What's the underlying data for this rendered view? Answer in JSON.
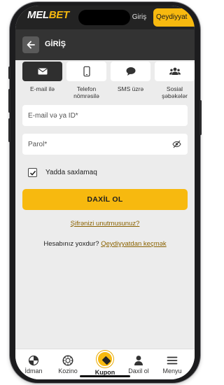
{
  "brand": {
    "mel": "MEL",
    "bet": "BET"
  },
  "header": {
    "login_label": "Giriş",
    "register_label": "Qeydiyyat"
  },
  "page_title": "GİRİŞ",
  "tabs": [
    {
      "label": "E-mail ilə",
      "icon": "envelope-icon",
      "active": true
    },
    {
      "label": "Telefon nömrəsilə",
      "icon": "phone-icon",
      "active": false
    },
    {
      "label": "SMS üzrə",
      "icon": "chat-icon",
      "active": false
    },
    {
      "label": "Sosial şəbəkələr",
      "icon": "people-icon",
      "active": false
    }
  ],
  "form": {
    "email_placeholder": "E-mail və ya İD*",
    "password_placeholder": "Parol*",
    "remember_label": "Yadda saxlamaq",
    "remember_checked": true,
    "submit_label": "DAXİL OL",
    "forgot_label": "Şifrənizi unutmusunuz?",
    "no_account_text": "Hesabınız yoxdur?",
    "register_link": "Qeydiyyatdan keçmək"
  },
  "bottom_nav": {
    "items": [
      {
        "label": "İdman",
        "icon": "sport-icon"
      },
      {
        "label": "Kozino",
        "icon": "casino-chip-icon"
      },
      {
        "label": "Kupon",
        "icon": "coupon-icon"
      },
      {
        "label": "Daxil ol",
        "icon": "user-icon"
      },
      {
        "label": "Menyu",
        "icon": "menu-icon"
      }
    ]
  },
  "colors": {
    "accent": "#f7b90f",
    "dark": "#232323",
    "background": "#ececec"
  }
}
